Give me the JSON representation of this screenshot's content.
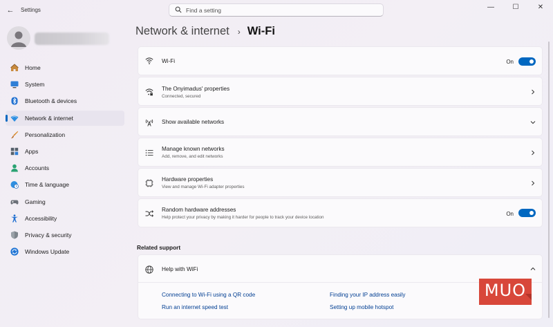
{
  "window": {
    "back_glyph": "←",
    "title": "Settings",
    "minimize_glyph": "—",
    "maximize_glyph": "☐",
    "close_glyph": "✕"
  },
  "search": {
    "placeholder": "Find a setting",
    "icon": "search-icon"
  },
  "sidebar": {
    "items": [
      {
        "label": "Home",
        "icon": "home-icon"
      },
      {
        "label": "System",
        "icon": "monitor-icon"
      },
      {
        "label": "Bluetooth & devices",
        "icon": "bluetooth-icon"
      },
      {
        "label": "Network & internet",
        "icon": "wifi-diamond-icon",
        "selected": true
      },
      {
        "label": "Personalization",
        "icon": "brush-icon"
      },
      {
        "label": "Apps",
        "icon": "apps-icon"
      },
      {
        "label": "Accounts",
        "icon": "person-icon"
      },
      {
        "label": "Time & language",
        "icon": "globe-clock-icon"
      },
      {
        "label": "Gaming",
        "icon": "controller-icon"
      },
      {
        "label": "Accessibility",
        "icon": "accessibility-icon"
      },
      {
        "label": "Privacy & security",
        "icon": "shield-icon"
      },
      {
        "label": "Windows Update",
        "icon": "update-icon"
      }
    ]
  },
  "breadcrumb": {
    "parent": "Network & internet",
    "separator": "›",
    "current": "Wi-Fi"
  },
  "settings": {
    "wifi": {
      "title": "Wi-Fi",
      "state": "On",
      "enabled": true
    },
    "properties": {
      "title": "The Onyimadus' properties",
      "subtitle": "Connected, secured"
    },
    "available": {
      "title": "Show available networks"
    },
    "known": {
      "title": "Manage known networks",
      "subtitle": "Add, remove, and edit networks"
    },
    "hardware": {
      "title": "Hardware properties",
      "subtitle": "View and manage Wi-Fi adapter properties"
    },
    "random": {
      "title": "Random hardware addresses",
      "subtitle": "Help protect your privacy by making it harder for people to track your device location",
      "state": "On",
      "enabled": true
    }
  },
  "related_support": {
    "title": "Related support",
    "help": {
      "title": "Help with WiFi",
      "expanded": true
    },
    "links": [
      "Connecting to Wi-Fi using a QR code",
      "Finding your IP address easily",
      "Run an internet speed test",
      "Setting up mobile hotspot"
    ]
  },
  "watermark": {
    "text": "MUO"
  },
  "colors": {
    "accent": "#0067c0",
    "link": "#003e92",
    "watermark": "#d8473a"
  }
}
